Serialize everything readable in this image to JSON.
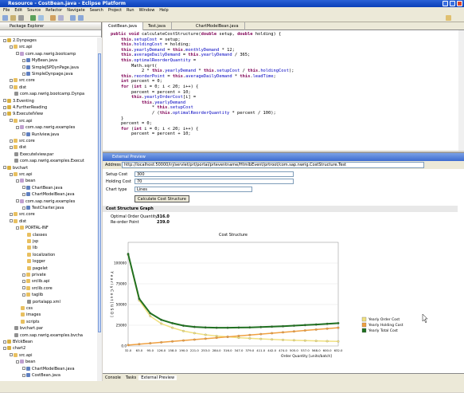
{
  "window": {
    "title": "Resource - CostBean.java - Eclipse Platform"
  },
  "menu": [
    "File",
    "Edit",
    "Source",
    "Refactor",
    "Navigate",
    "Search",
    "Project",
    "Run",
    "Window",
    "Help"
  ],
  "left_panel": {
    "title": "Package Explorer",
    "tabs": [
      "Navigator",
      "Outline",
      "Package Explorer"
    ],
    "tree": [
      {
        "label": "2.Dynpages",
        "depth": 0,
        "kind": "project",
        "exp": "-"
      },
      {
        "label": "src.api",
        "depth": 1,
        "kind": "folder",
        "exp": "-"
      },
      {
        "label": "com.sap.nwrig.bootcamp",
        "depth": 2,
        "kind": "package",
        "exp": "-"
      },
      {
        "label": "MyBean.java",
        "depth": 3,
        "kind": "java",
        "exp": "+"
      },
      {
        "label": "SimpleJSPDynPage.java",
        "depth": 3,
        "kind": "java",
        "exp": "+"
      },
      {
        "label": "SimpleDynpage.java",
        "depth": 3,
        "kind": "java",
        "exp": "+"
      },
      {
        "label": "src.core",
        "depth": 1,
        "kind": "folder",
        "exp": "+"
      },
      {
        "label": "dist",
        "depth": 1,
        "kind": "folder",
        "exp": "+"
      },
      {
        "label": "com.sap.nwrig.bootcamp.Dynpa",
        "depth": 1,
        "kind": "file",
        "exp": ""
      },
      {
        "label": "3.Eventing",
        "depth": 0,
        "kind": "project",
        "exp": "+"
      },
      {
        "label": "4.FurtherReading",
        "depth": 0,
        "kind": "project",
        "exp": "+"
      },
      {
        "label": "9.ExecuteIView",
        "depth": 0,
        "kind": "project",
        "exp": "-"
      },
      {
        "label": "src.api",
        "depth": 1,
        "kind": "folder",
        "exp": "-"
      },
      {
        "label": "com.sap.nwrig.examples",
        "depth": 2,
        "kind": "package",
        "exp": "-"
      },
      {
        "label": "RunIview.java",
        "depth": 3,
        "kind": "java",
        "exp": "+"
      },
      {
        "label": "src.core",
        "depth": 1,
        "kind": "folder",
        "exp": "+"
      },
      {
        "label": "dist",
        "depth": 1,
        "kind": "folder",
        "exp": "+"
      },
      {
        "label": "ExecuteIview.par",
        "depth": 1,
        "kind": "file",
        "exp": ""
      },
      {
        "label": "com.sap.nwrig.examples.Execut",
        "depth": 1,
        "kind": "file",
        "exp": ""
      },
      {
        "label": "bvchart",
        "depth": 0,
        "kind": "project",
        "exp": "-"
      },
      {
        "label": "src.api",
        "depth": 1,
        "kind": "folder",
        "exp": "-"
      },
      {
        "label": "bean",
        "depth": 2,
        "kind": "package",
        "exp": "-"
      },
      {
        "label": "ChartBean.java",
        "depth": 3,
        "kind": "java",
        "exp": "+"
      },
      {
        "label": "ChartModelBean.java",
        "depth": 3,
        "kind": "java",
        "exp": "+"
      },
      {
        "label": "com.sap.nwrig.examples",
        "depth": 2,
        "kind": "package",
        "exp": "-"
      },
      {
        "label": "TestCharter.java",
        "depth": 3,
        "kind": "java",
        "exp": "+"
      },
      {
        "label": "src.core",
        "depth": 1,
        "kind": "folder",
        "exp": "+"
      },
      {
        "label": "dist",
        "depth": 1,
        "kind": "folder",
        "exp": "-"
      },
      {
        "label": "PORTAL-INF",
        "depth": 2,
        "kind": "folder",
        "exp": "-"
      },
      {
        "label": "classes",
        "depth": 3,
        "kind": "folder",
        "exp": ""
      },
      {
        "label": "jsp",
        "depth": 3,
        "kind": "folder",
        "exp": ""
      },
      {
        "label": "lib",
        "depth": 3,
        "kind": "folder",
        "exp": ""
      },
      {
        "label": "localization",
        "depth": 3,
        "kind": "folder",
        "exp": ""
      },
      {
        "label": "logger",
        "depth": 3,
        "kind": "folder",
        "exp": ""
      },
      {
        "label": "pagelet",
        "depth": 3,
        "kind": "folder",
        "exp": ""
      },
      {
        "label": "private",
        "depth": 3,
        "kind": "folder",
        "exp": "+"
      },
      {
        "label": "srclib.api",
        "depth": 3,
        "kind": "folder",
        "exp": "+"
      },
      {
        "label": "srclib.core",
        "depth": 3,
        "kind": "folder",
        "exp": "+"
      },
      {
        "label": "taglib",
        "depth": 3,
        "kind": "folder",
        "exp": "+"
      },
      {
        "label": "portalapp.xml",
        "depth": 3,
        "kind": "file",
        "exp": ""
      },
      {
        "label": "css",
        "depth": 2,
        "kind": "folder",
        "exp": ""
      },
      {
        "label": "images",
        "depth": 2,
        "kind": "folder",
        "exp": ""
      },
      {
        "label": "scripts",
        "depth": 2,
        "kind": "folder",
        "exp": ""
      },
      {
        "label": "bvchart.par",
        "depth": 1,
        "kind": "file",
        "exp": ""
      },
      {
        "label": "com.sap.nwrig.examples.bvcha",
        "depth": 1,
        "kind": "file",
        "exp": ""
      },
      {
        "label": "BVckBean",
        "depth": 0,
        "kind": "project",
        "exp": "+"
      },
      {
        "label": "chart2",
        "depth": 0,
        "kind": "project",
        "exp": "-"
      },
      {
        "label": "src.api",
        "depth": 1,
        "kind": "folder",
        "exp": "-"
      },
      {
        "label": "bean",
        "depth": 2,
        "kind": "package",
        "exp": "-"
      },
      {
        "label": "ChartModelBean.java",
        "depth": 3,
        "kind": "java",
        "exp": "+"
      },
      {
        "label": "CostBean.java",
        "depth": 3,
        "kind": "java",
        "exp": "+"
      }
    ]
  },
  "editor": {
    "tabs": [
      "CostBean.java",
      "Test.java",
      "ChartModelBean.java"
    ],
    "lines": [
      "public void calculateCostStructure(double setup, double holding) {",
      "    this.setupCost = setup;",
      "    this.holdingCost = holding;",
      "    this.yearlyDemand = this.monthlyDemand * 12;",
      "    this.averageDailyDemand = this.yearlyDemand / 365;",
      "    this.optimalReorderQuantity =",
      "        Math.sqrt(",
      "            2 * this.yearlyDemand * this.setupCost / this.holdingCost);",
      "    this.reorderPoint = this.averageDailyDemand * this.leadTime;",
      "    int percent = 0;",
      "    for (int i = 0; i < 20; i++) {",
      "        percent = percent + 10;",
      "        this.yearlyOrderCost[i] =",
      "            this.yearlyDemand",
      "                * this.setupCost",
      "                / (this.optimalReorderQuantity * percent / 100);",
      "    }",
      "    percent = 0;",
      "    for (int i = 0; i < 20; i++) {",
      "        percent = percent + 10;"
    ]
  },
  "preview": {
    "title": "External Preview",
    "address_label": "Address",
    "address": "http://localhost:50000/irj/servlet/prt/portal/prteventname/HtmlbEvent/prtroot/com.sap.nwrig.CostStructure.Test",
    "setup_label": "Setup Cost",
    "setup_value": "300",
    "holding_label": "Holding Cost",
    "holding_value": "70",
    "type_label": "Chart type",
    "type_value": "Lines",
    "calc_button": "Calculate Cost Structure",
    "graph_header": "Cost Structure Graph",
    "oq_label": "Optimal Order Quantity",
    "oq_value": "316.0",
    "rp_label": "Re-order Point",
    "rp_value": "239.0",
    "tabs": [
      "Console",
      "Tasks",
      "External Preview"
    ]
  },
  "chart_data": {
    "type": "line",
    "title": "Cost Structure",
    "xlabel": "Order Quantity [units/batch]",
    "ylabel": "Y e a r l y   C o s t   [ U S D ]",
    "ylim": [
      0,
      125000
    ],
    "yticks": [
      0,
      25000,
      50000,
      75000,
      100000
    ],
    "ytick_labels": [
      "0.0",
      "25000",
      "50000",
      "75000",
      "100000"
    ],
    "x": [
      32.0,
      63.0,
      95.0,
      126.0,
      158.0,
      190.0,
      221.0,
      253.0,
      284.0,
      316.0,
      347.0,
      379.0,
      411.0,
      442.0,
      474.0,
      505.0,
      537.0,
      568.0,
      600.0,
      632.0
    ],
    "x_labels": [
      "32.0",
      "63.0",
      "95.0",
      "126.0",
      "158.0",
      "190.0",
      "221.0",
      "253.0",
      "284.0",
      "316.0",
      "347.0",
      "379.0",
      "411.0",
      "442.0",
      "474.0",
      "505.0",
      "537.0",
      "568.0",
      "600.0",
      "632.0"
    ],
    "series": [
      {
        "name": "Yearly Order Cost",
        "color": "#f0e080",
        "values": [
          110000,
          55000,
          36000,
          27000,
          22000,
          18000,
          15500,
          13500,
          12000,
          11000,
          10000,
          9200,
          8500,
          7900,
          7300,
          6900,
          6500,
          6100,
          5800,
          5500
        ]
      },
      {
        "name": "Yearly Holding Cost",
        "color": "#f0a040",
        "values": [
          1100,
          2200,
          3300,
          4400,
          5500,
          6600,
          7700,
          8800,
          9900,
          11000,
          12100,
          13200,
          14300,
          15400,
          16500,
          17600,
          18700,
          19800,
          20900,
          22000
        ]
      },
      {
        "name": "Yearly Total Cost",
        "color": "#207020",
        "values": [
          111000,
          57000,
          39500,
          31500,
          27500,
          24500,
          23000,
          22300,
          22000,
          22000,
          22200,
          22400,
          22800,
          23300,
          23800,
          24500,
          25200,
          25900,
          26700,
          27500
        ]
      }
    ]
  }
}
